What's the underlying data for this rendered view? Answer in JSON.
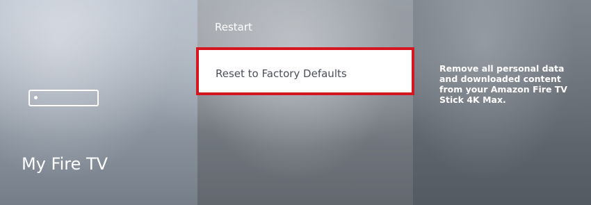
{
  "sidebar": {
    "device_icon": "fire-tv-stick-icon",
    "title": "My Fire TV"
  },
  "menu": {
    "items": [
      {
        "label": "Restart",
        "selected": false
      },
      {
        "label": "Reset to Factory Defaults",
        "selected": true
      }
    ]
  },
  "detail": {
    "description": "Remove all personal data and downloaded content from your Amazon Fire TV Stick 4K Max."
  },
  "colors": {
    "highlight_border": "#d3161f",
    "selected_bg": "#ffffff",
    "selected_text": "#4a4f57",
    "text": "#ffffff"
  }
}
